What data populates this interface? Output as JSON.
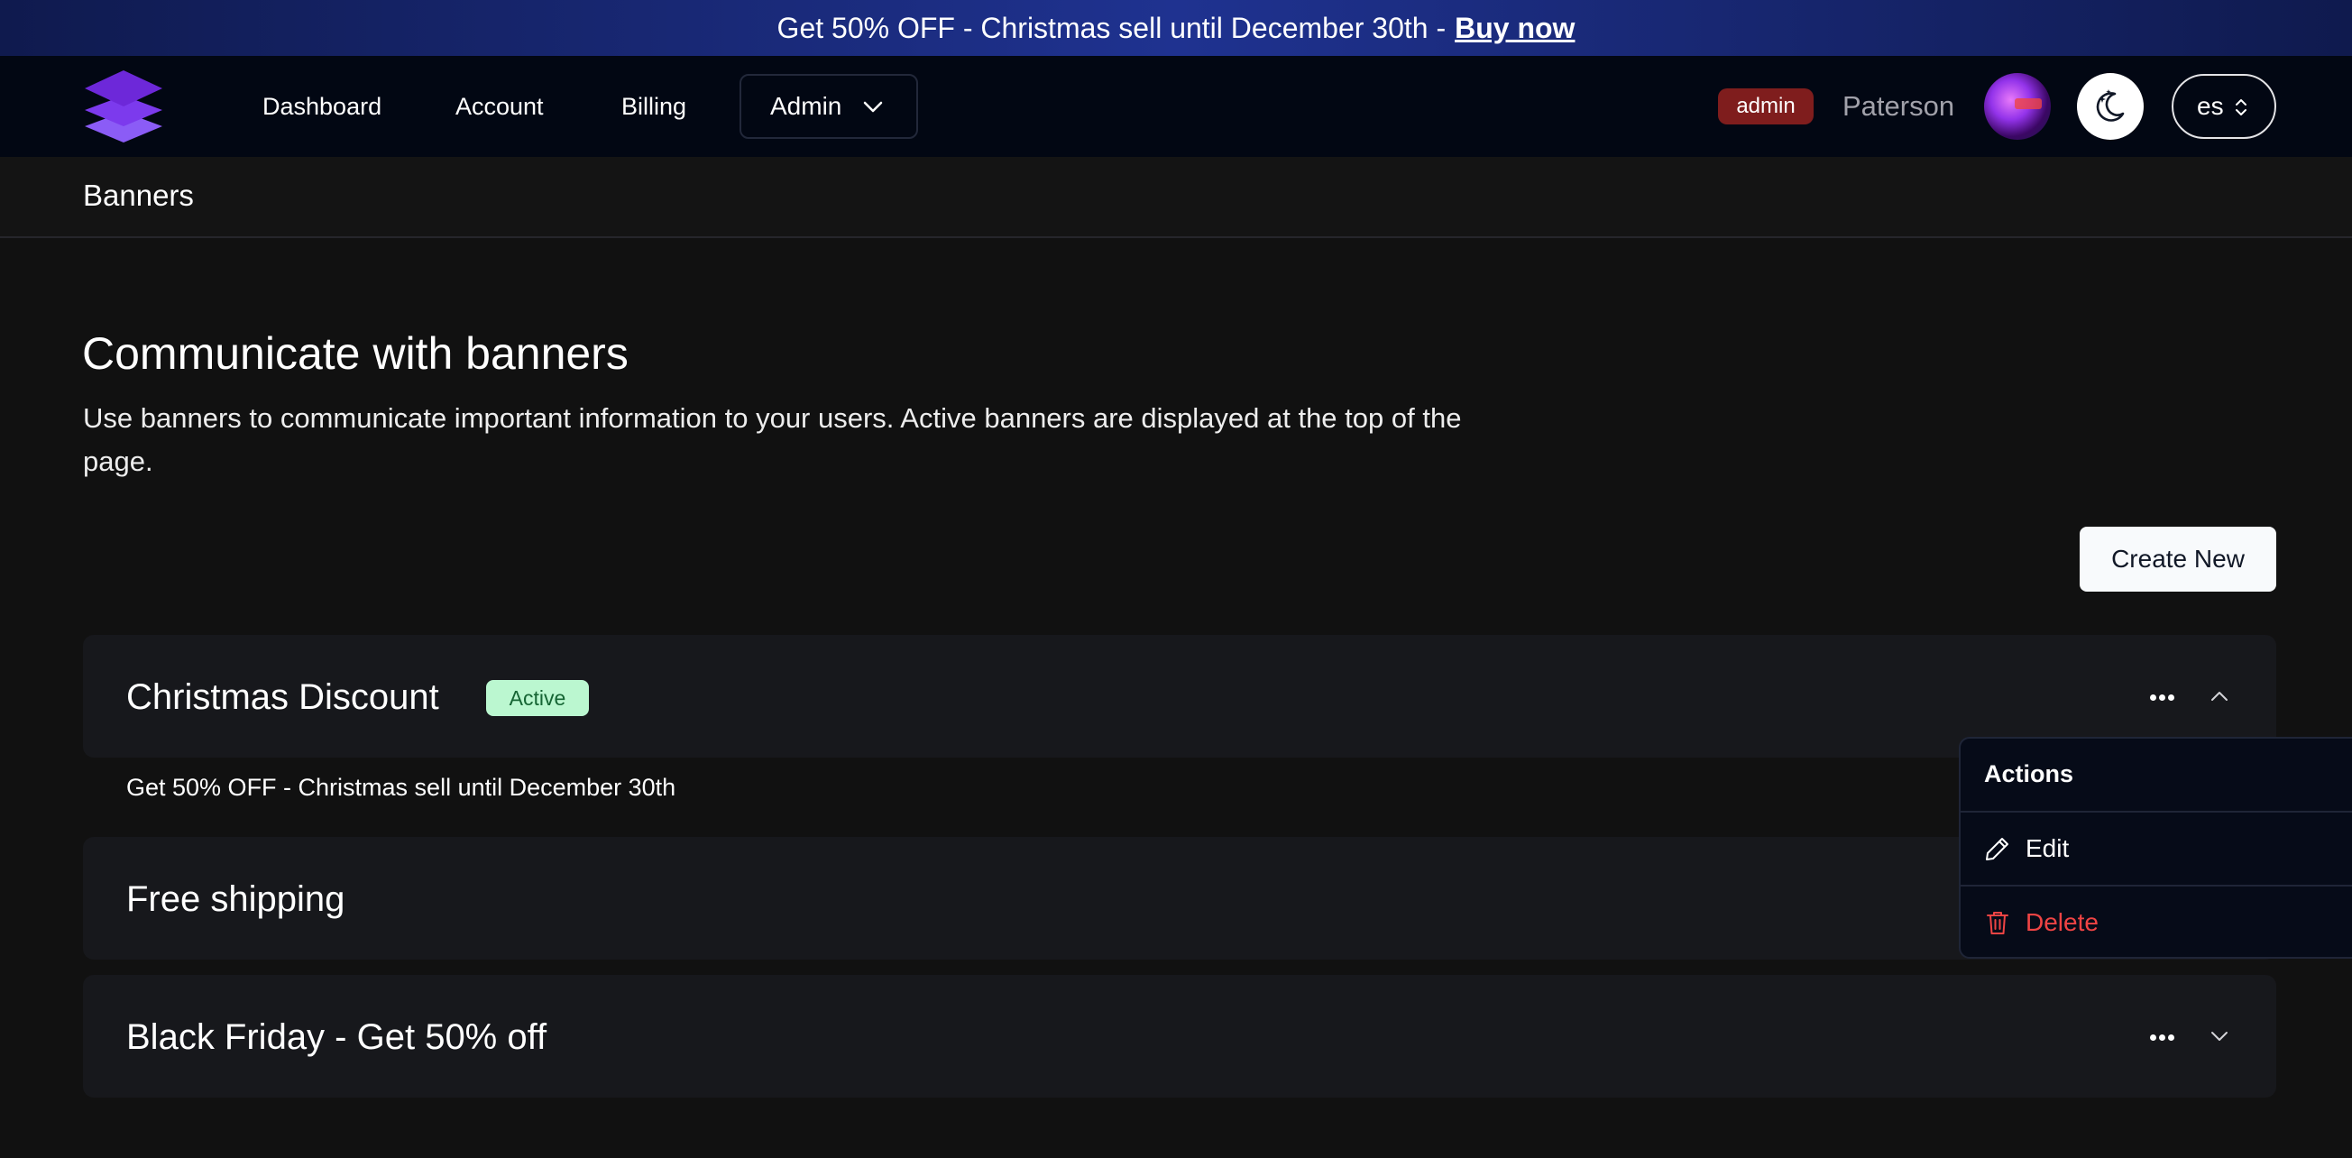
{
  "promo": {
    "text": "Get 50% OFF - Christmas sell until December 30th -",
    "link": "Buy now"
  },
  "nav": {
    "links": [
      "Dashboard",
      "Account",
      "Billing"
    ],
    "admin_label": "Admin",
    "role_badge": "admin",
    "username": "Paterson",
    "language": "es"
  },
  "breadcrumb": "Banners",
  "page": {
    "title": "Communicate with banners",
    "description": "Use banners to communicate important information to your users. Active banners are displayed at the top of the page.",
    "create_button": "Create New"
  },
  "banners": [
    {
      "title": "Christmas Discount",
      "status": "Active",
      "message": "Get 50% OFF - Christmas sell until December 30th",
      "expanded": true
    },
    {
      "title": "Free shipping"
    },
    {
      "title": "Black Friday - Get 50% off",
      "expanded": false
    }
  ],
  "actions_menu": {
    "header": "Actions",
    "edit": "Edit",
    "delete": "Delete"
  },
  "colors": {
    "accent": "#7c3aed",
    "active_badge_bg": "#bbf7d0",
    "active_badge_text": "#166534",
    "admin_badge": "#7f1d1d",
    "delete": "#ef4444"
  },
  "icons": {
    "logo": "layers-logo",
    "admin_menu": "chevron-down-icon",
    "theme": "moon-stars-icon",
    "language": "chevron-up-down-icon",
    "more": "ellipsis-icon",
    "collapse": "chevron-up-icon",
    "expand": "chevron-down-icon",
    "edit": "pencil-icon",
    "delete": "trash-icon"
  }
}
